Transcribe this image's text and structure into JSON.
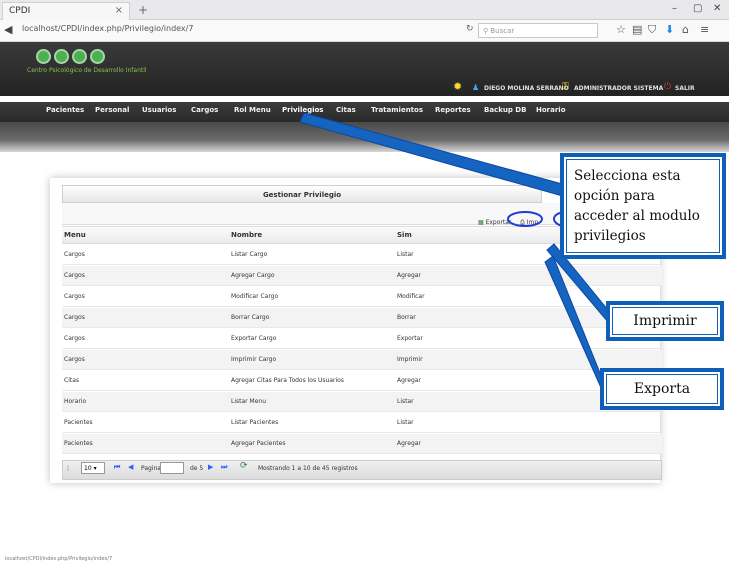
{
  "browser": {
    "tab_title": "CPDI",
    "tab_close": "×",
    "new_tab": "+",
    "url": "localhost/CPDI/index.php/Privilegio/index/7",
    "search_placeholder": "Buscar"
  },
  "app": {
    "logo_text": "Centro Psicológico de Desarrollo Infantil",
    "user_name": "DIEGO MOLINA SERRANO",
    "role": "ADMINISTRADOR SISTEMA",
    "logout": "SALIR"
  },
  "menu": [
    {
      "label": "Pacientes"
    },
    {
      "label": "Personal"
    },
    {
      "label": "Usuarios"
    },
    {
      "label": "Cargos"
    },
    {
      "label": "Rol Menu"
    },
    {
      "label": "Privilegios",
      "active": true
    },
    {
      "label": "Citas"
    },
    {
      "label": "Tratamientos"
    },
    {
      "label": "Reportes"
    },
    {
      "label": "Backup DB"
    },
    {
      "label": "Horario"
    }
  ],
  "grid": {
    "title": "Gestionar Privilegio",
    "export_label": "Exportar",
    "print_label": "Imp",
    "columns": [
      "Menu",
      "Nombre",
      "Sim"
    ],
    "rows": [
      [
        "Cargos",
        "Listar Cargo",
        "Listar"
      ],
      [
        "Cargos",
        "Agregar Cargo",
        "Agregar"
      ],
      [
        "Cargos",
        "Modificar Cargo",
        "Modificar"
      ],
      [
        "Cargos",
        "Borrar Cargo",
        "Borrar"
      ],
      [
        "Cargos",
        "Exportar Cargo",
        "Exportar"
      ],
      [
        "Cargos",
        "Imprimir Cargo",
        "Imprimir"
      ],
      [
        "Citas",
        "Agregar Citas Para Todos los Usuarios",
        "Agregar"
      ],
      [
        "Horario",
        "Listar Menu",
        "Listar"
      ],
      [
        "Pacientes",
        "Listar Pacientes",
        "Listar"
      ],
      [
        "Pacientes",
        "Agregar Pacientes",
        "Agregar"
      ]
    ]
  },
  "pager": {
    "page_size": "10",
    "page_label": "Pagina",
    "of_label": "de 5",
    "info": "Mostrando 1 a 10 de 45 registros"
  },
  "callouts": {
    "main": "Selecciona esta opción para acceder al modulo privilegios",
    "print": "Imprimir",
    "export": "Exporta"
  },
  "status_url": "localhost/CPDI/index.php/Privilegio/index/7",
  "colors": {
    "callout_border": "#0d5fb7",
    "logo_green": "#4caf50"
  }
}
